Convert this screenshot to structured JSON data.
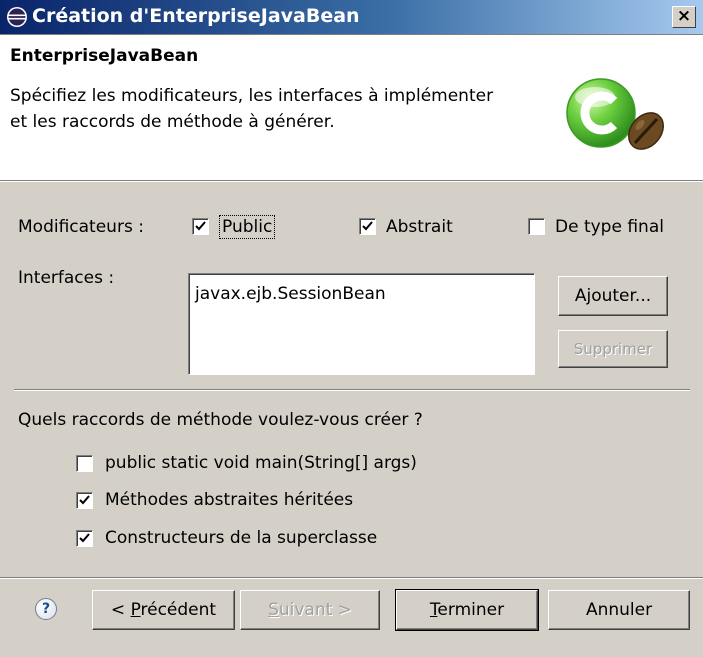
{
  "window": {
    "title": "Création d'EnterpriseJavaBean",
    "close_label": "×"
  },
  "banner": {
    "title": "EnterpriseJavaBean",
    "desc_line1": "Spécifiez les modificateurs, les interfaces à implémenter",
    "desc_line2": "et les raccords de méthode à générer."
  },
  "modifiers": {
    "label": "Modificateurs :",
    "options": [
      {
        "label": "Public",
        "checked": true
      },
      {
        "label": "Abstrait",
        "checked": true
      },
      {
        "label": "De type final",
        "checked": false
      }
    ]
  },
  "interfaces": {
    "label": "Interfaces :",
    "items": [
      "javax.ejb.SessionBean"
    ],
    "add_button": "Ajouter...",
    "remove_button": "Supprimer"
  },
  "stubs": {
    "question": "Quels raccords de méthode voulez-vous créer ?",
    "options": [
      {
        "label": "public static void main(String[] args)",
        "checked": false
      },
      {
        "label": "Méthodes abstraites héritées",
        "checked": true
      },
      {
        "label": "Constructeurs de la superclasse",
        "checked": true
      }
    ]
  },
  "footer": {
    "help": "?",
    "back_prefix": "< ",
    "back_mnemonic": "P",
    "back_rest": "récédent",
    "next_mnemonic": "S",
    "next_rest": "uivant >",
    "finish_mnemonic": "T",
    "finish_rest": "erminer",
    "cancel": "Annuler"
  },
  "colors": {
    "dialog_bg": "#d4d0c8",
    "titlebar_start": "#0a246a",
    "titlebar_end": "#a6caf0",
    "logo_green": "#5fc53a",
    "bean_brown": "#6b4a22"
  },
  "icons": {
    "window": "eclipse-icon",
    "logo": "class-c-icon",
    "bean": "coffee-bean-icon",
    "help": "help-icon"
  }
}
